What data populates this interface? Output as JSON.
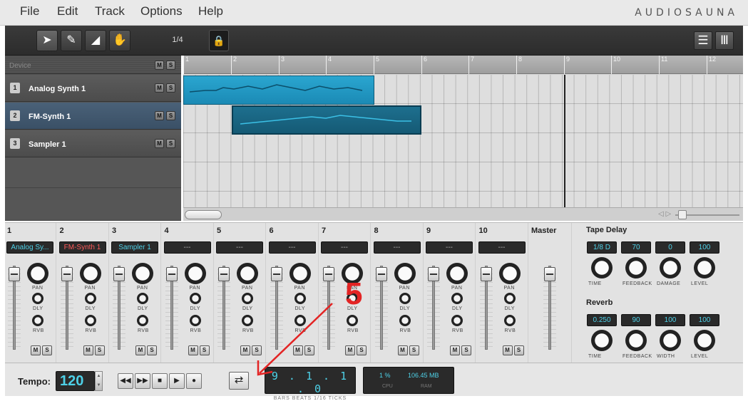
{
  "menu": {
    "items": [
      "File",
      "Edit",
      "Track",
      "Options",
      "Help"
    ],
    "brand": "AUDIOSAUNA"
  },
  "toolbar": {
    "tools": [
      {
        "icon": "pointer-icon",
        "glyph": "➤"
      },
      {
        "icon": "pencil-icon",
        "glyph": "✎"
      },
      {
        "icon": "eraser-icon",
        "glyph": "◢"
      },
      {
        "icon": "hand-icon",
        "glyph": "✋"
      }
    ],
    "quantize": "1/4",
    "lock_glyph": "🔒",
    "view_list_glyph": "☰",
    "view_mixer_glyph": "Ⅲ"
  },
  "tracks": {
    "header_label": "Device",
    "m": "M",
    "s": "S",
    "items": [
      {
        "num": "1",
        "name": "Analog Synth 1"
      },
      {
        "num": "2",
        "name": "FM-Synth 1",
        "selected": true
      },
      {
        "num": "3",
        "name": "Sampler 1"
      }
    ]
  },
  "ruler": {
    "bars": [
      "1",
      "2",
      "3",
      "4",
      "5",
      "6",
      "7",
      "8",
      "9",
      "10",
      "11",
      "12"
    ]
  },
  "mixer": {
    "labels": {
      "pan": "PAN",
      "dly": "DLY",
      "rvb": "RVB",
      "m": "M",
      "s": "S"
    },
    "channels": [
      {
        "num": "1",
        "name": "Analog Sy...",
        "color": "#4ed1e8"
      },
      {
        "num": "2",
        "name": "FM-Synth 1",
        "color": "#ff5a5a"
      },
      {
        "num": "3",
        "name": "Sampler 1",
        "color": "#4ed1e8"
      },
      {
        "num": "4",
        "name": "---",
        "color": "#aaaaaa"
      },
      {
        "num": "5",
        "name": "---",
        "color": "#aaaaaa"
      },
      {
        "num": "6",
        "name": "---",
        "color": "#aaaaaa"
      },
      {
        "num": "7",
        "name": "---",
        "color": "#aaaaaa"
      },
      {
        "num": "8",
        "name": "---",
        "color": "#aaaaaa"
      },
      {
        "num": "9",
        "name": "---",
        "color": "#aaaaaa"
      },
      {
        "num": "10",
        "name": "---",
        "color": "#aaaaaa"
      }
    ],
    "master": "Master",
    "tape_delay": {
      "title": "Tape Delay",
      "values": [
        "1/8 D",
        "70",
        "0",
        "100"
      ],
      "knobs": [
        "TIME",
        "FEEDBACK",
        "DAMAGE",
        "LEVEL"
      ]
    },
    "reverb": {
      "title": "Reverb",
      "values": [
        "0.250",
        "90",
        "100",
        "100"
      ],
      "knobs": [
        "TIME",
        "FEEDBACK",
        "WIDTH",
        "LEVEL"
      ]
    }
  },
  "transport": {
    "tempo_label": "Tempo:",
    "tempo": "120",
    "buttons": [
      {
        "icon": "rewind-icon",
        "glyph": "◀◀"
      },
      {
        "icon": "fast-forward-icon",
        "glyph": "▶▶"
      },
      {
        "icon": "stop-icon",
        "glyph": "■"
      },
      {
        "icon": "play-icon",
        "glyph": "▶"
      },
      {
        "icon": "record-icon",
        "glyph": "●"
      }
    ],
    "loop_glyph": "⇄",
    "position": "9 . 1 . 1 . 0",
    "position_caption": "BARS BEATS 1/16 TICKS",
    "cpu": "1 %",
    "ram": "106.45 MB",
    "cpu_label": "CPU",
    "ram_label": "RAM"
  },
  "annotation": {
    "number": "5",
    "color": "#e32424"
  }
}
